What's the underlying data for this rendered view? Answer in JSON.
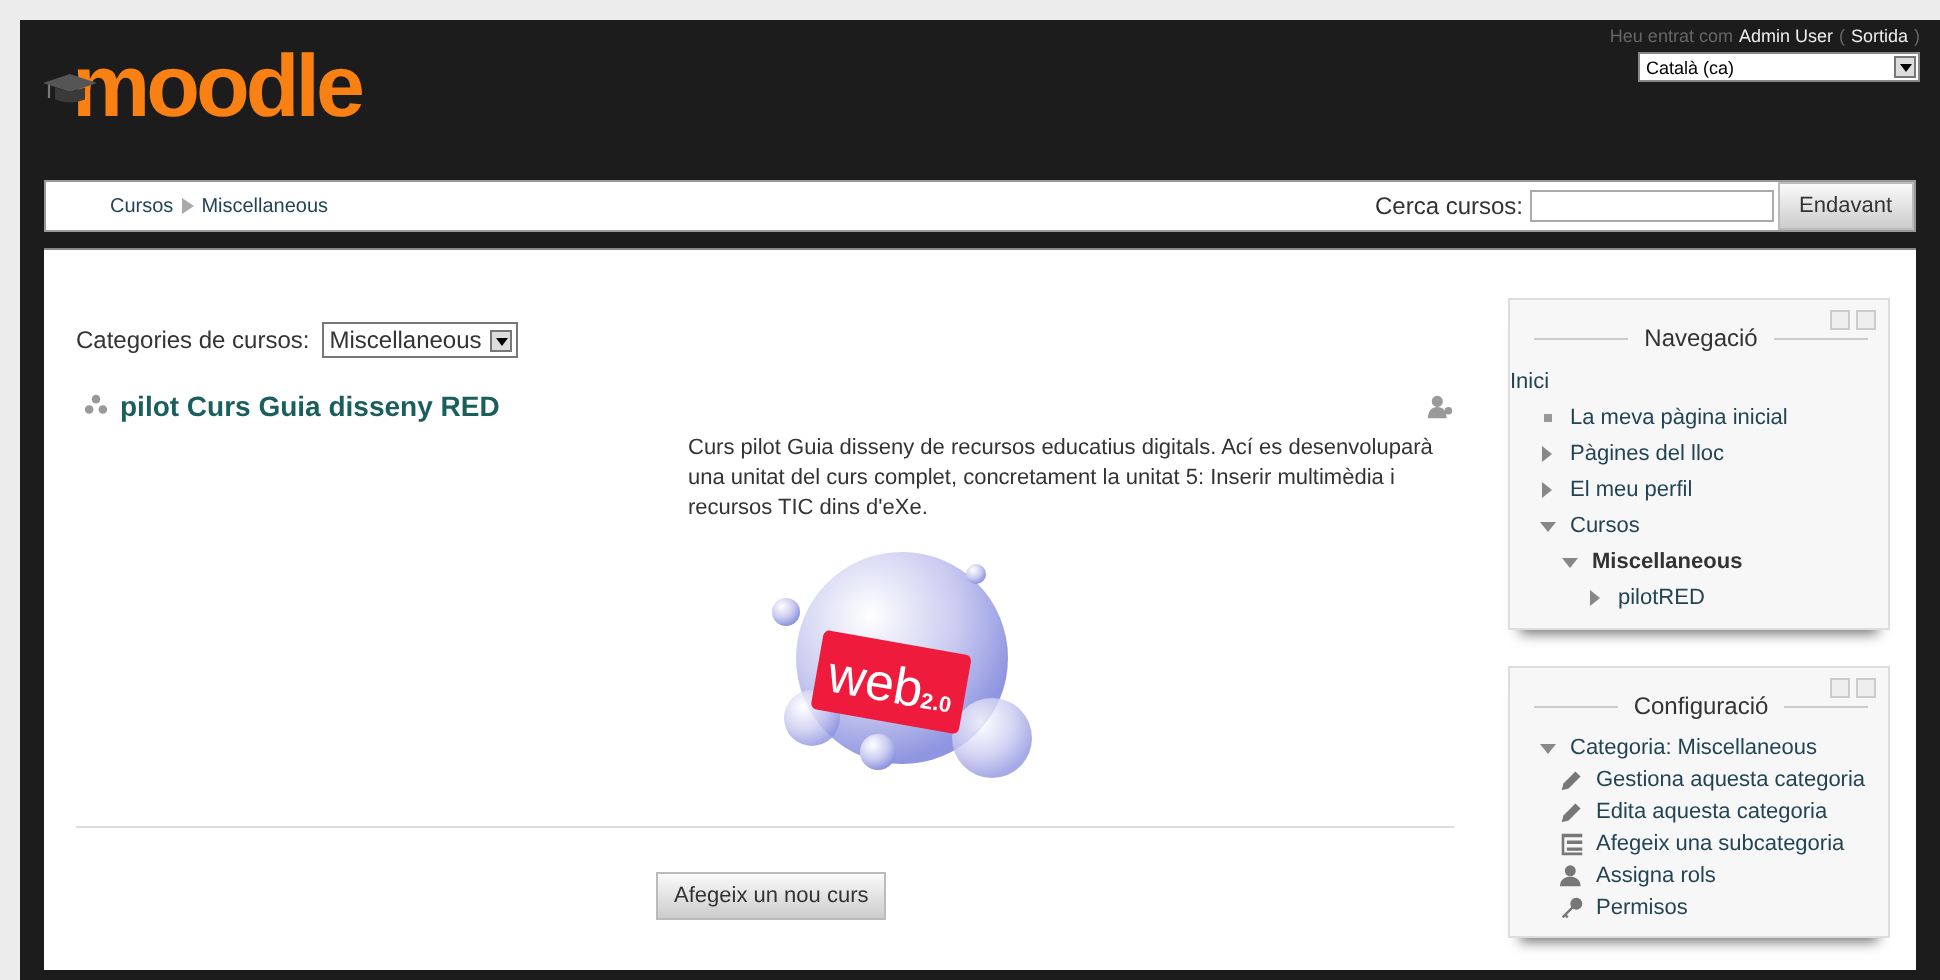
{
  "header": {
    "logo": "moodle",
    "login": {
      "prefix": "Heu entrat com",
      "user": "Admin User",
      "paren_open": "(",
      "logout": "Sortida",
      "paren_close": ")"
    },
    "language": {
      "value": "Català (ca)"
    }
  },
  "navbar": {
    "breadcrumb": [
      "Cursos",
      "Miscellaneous"
    ],
    "search": {
      "label": "Cerca cursos:",
      "button": "Endavant"
    }
  },
  "main": {
    "category": {
      "label": "Categories de cursos:",
      "value": "Miscellaneous"
    },
    "course": {
      "title": "pilot Curs Guia disseny RED",
      "summary": "Curs pilot Guia disseny de recursos educatius digitals. Ací es desenvoluparà una unitat del curs complet, concretament la unitat 5: Inserir multimèdia i recursos TIC dins d'eXe.",
      "image_label": "web",
      "image_sub": "2.0"
    },
    "add_button": "Afegeix un nou curs"
  },
  "navigation": {
    "title": "Navegació",
    "items": [
      {
        "label": "Inici",
        "kind": "root"
      },
      {
        "label": "La meva pàgina inicial",
        "kind": "leaf"
      },
      {
        "label": "Pàgines del lloc",
        "kind": "branch",
        "expanded": false
      },
      {
        "label": "El meu perfil",
        "kind": "branch",
        "expanded": false
      },
      {
        "label": "Cursos",
        "kind": "branch",
        "expanded": true,
        "children": [
          {
            "label": "Miscellaneous",
            "kind": "branch",
            "expanded": true,
            "bold": true,
            "children": [
              {
                "label": "pilotRED",
                "kind": "branch",
                "expanded": false
              }
            ]
          }
        ]
      }
    ]
  },
  "settings": {
    "title": "Configuració",
    "items": [
      {
        "label": "Categoria: Miscellaneous",
        "kind": "branch",
        "expanded": true,
        "children": [
          {
            "label": "Gestiona aquesta categoria",
            "kind": "pencil"
          },
          {
            "label": "Edita aquesta categoria",
            "kind": "pencil"
          },
          {
            "label": "Afegeix una subcategoria",
            "kind": "list"
          },
          {
            "label": "Assigna rols",
            "kind": "user"
          },
          {
            "label": "Permisos",
            "kind": "key"
          }
        ]
      }
    ]
  }
}
